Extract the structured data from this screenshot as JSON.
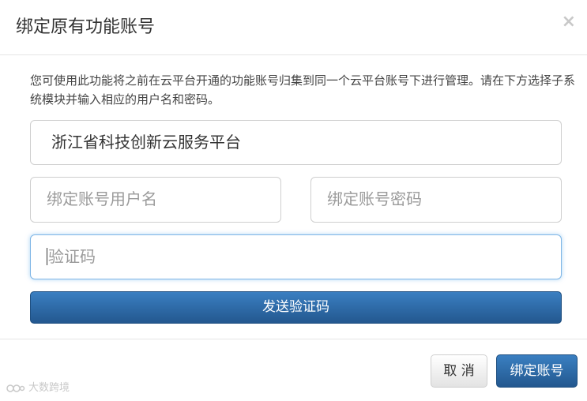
{
  "dialog": {
    "title": "绑定原有功能账号",
    "close_symbol": "×"
  },
  "description": "您可使用此功能将之前在云平台开通的功能账号归集到同一个云平台账号下进行管理。请在下方选择子系统模块并输入相应的用户名和密码。",
  "form": {
    "system_value": "浙江省科技创新云服务平台",
    "username_placeholder": "绑定账号用户名",
    "password_placeholder": "绑定账号密码",
    "code_placeholder": "验证码"
  },
  "buttons": {
    "send_code": "发送验证码",
    "cancel": "取 消",
    "confirm": "绑定账号"
  },
  "watermark": {
    "text": "大数跨境"
  },
  "colors": {
    "primary": "#2d6aa8",
    "focus_border": "#7fb6e6"
  }
}
